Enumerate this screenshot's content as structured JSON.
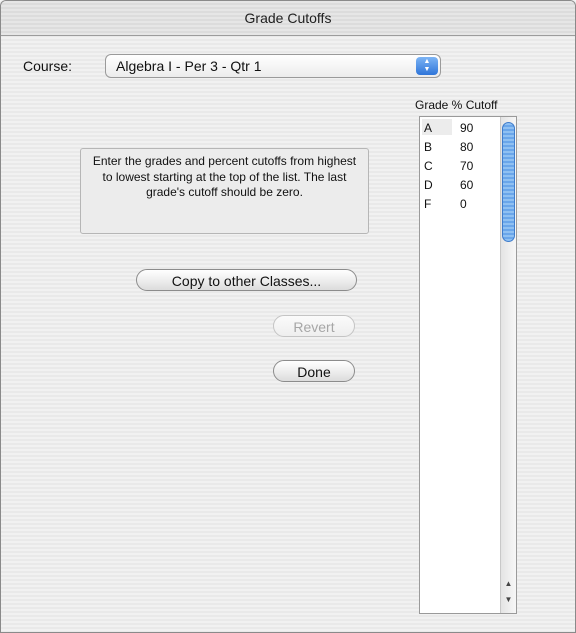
{
  "window": {
    "title": "Grade Cutoffs"
  },
  "course": {
    "label": "Course:",
    "selected": "Algebra I - Per 3 - Qtr 1"
  },
  "instructions": "Enter the grades and percent cutoffs from highest to lowest starting at the top of the list.  The last grade's cutoff should be zero.",
  "buttons": {
    "copy": "Copy to other Classes...",
    "revert": "Revert",
    "done": "Done"
  },
  "table": {
    "header": "Grade % Cutoff",
    "rows": [
      {
        "grade": "A",
        "cutoff": "90"
      },
      {
        "grade": "B",
        "cutoff": "80"
      },
      {
        "grade": "C",
        "cutoff": "70"
      },
      {
        "grade": "D",
        "cutoff": "60"
      },
      {
        "grade": "F",
        "cutoff": "0"
      }
    ]
  },
  "colors": {
    "accent": "#3b82e6",
    "window_bg": "#eeeeee"
  },
  "icons": {
    "popup": "up-down-arrows-icon",
    "scroll_up": "triangle-up-icon",
    "scroll_down": "triangle-down-icon"
  }
}
